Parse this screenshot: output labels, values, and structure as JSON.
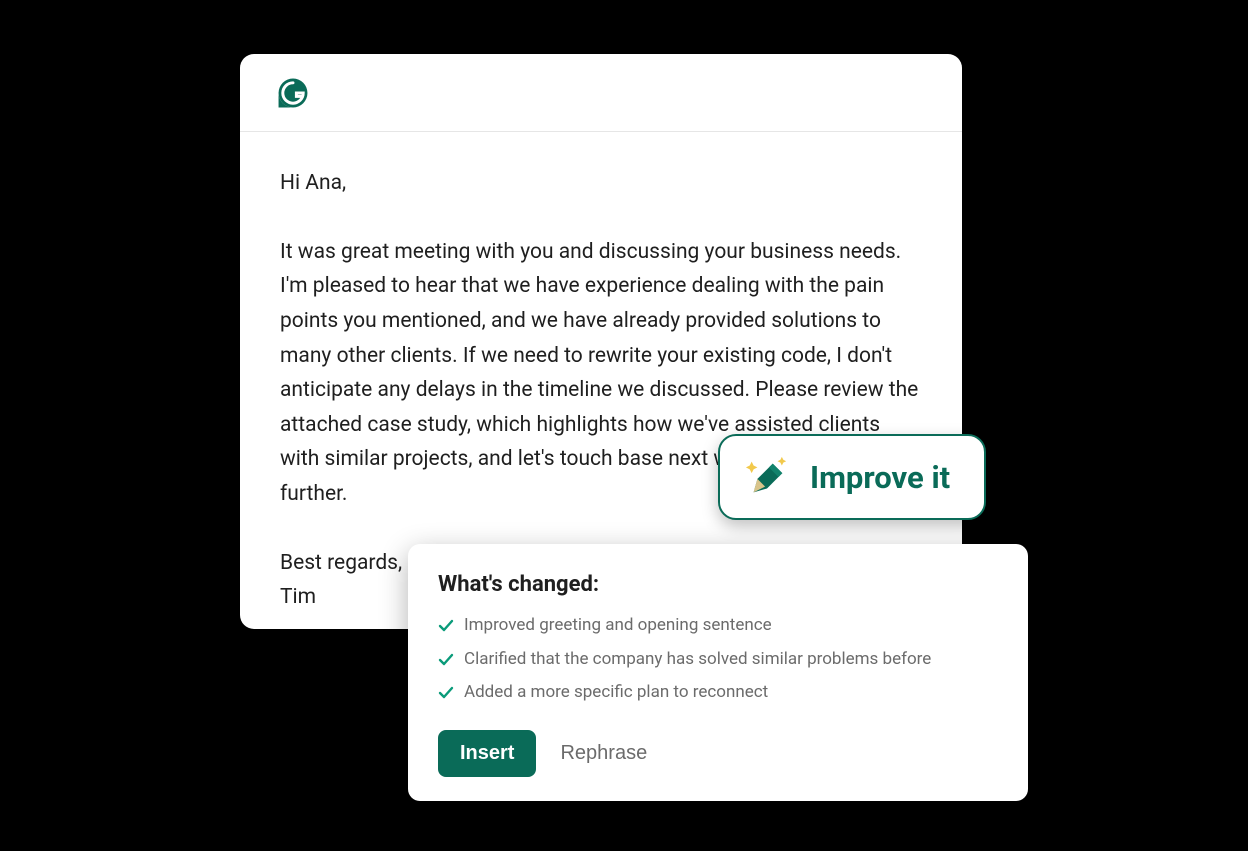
{
  "colors": {
    "brand": "#0a6b58"
  },
  "editor": {
    "greeting": "Hi Ana,",
    "body": "It was great meeting with you and discussing your business needs. I'm pleased to hear that we have experience dealing with the pain points you mentioned, and we have already provided solutions to many other clients. If we need to rewrite your existing code, I don't anticipate any delays in the timeline we discussed. Please review the attached case study, which highlights how we've assisted clients with similar projects, and let's touch base next week to discuss further.",
    "closing": "Best regards,",
    "signature": "Tim"
  },
  "improve": {
    "label": "Improve it"
  },
  "changes": {
    "title": "What's changed:",
    "items": [
      "Improved greeting and opening sentence",
      "Clarified that the company has solved similar problems before",
      "Added a more specific plan to reconnect"
    ],
    "insert_label": "Insert",
    "rephrase_label": "Rephrase"
  }
}
